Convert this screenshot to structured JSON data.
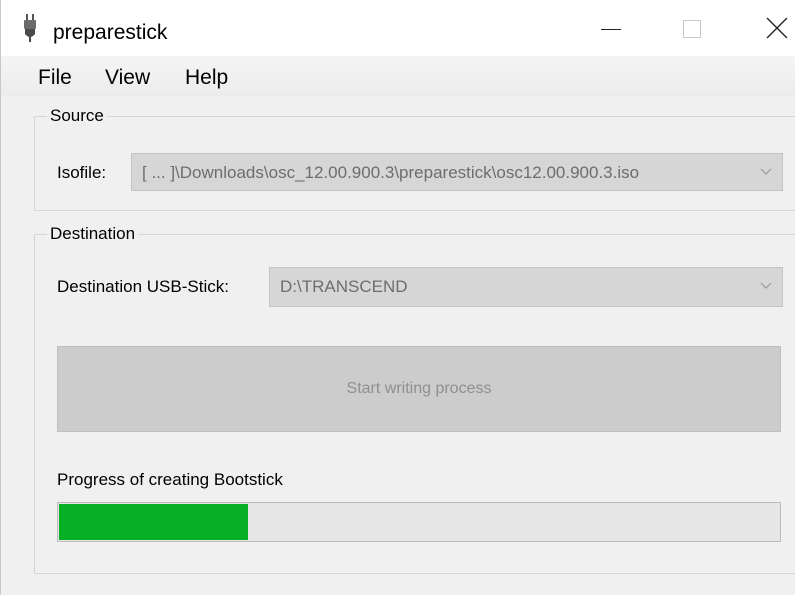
{
  "window": {
    "title": "preparestick",
    "app_icon": "usb-plug-icon",
    "controls": {
      "minimize": "minimize-icon",
      "maximize": "maximize-icon",
      "close": "close-icon"
    }
  },
  "menu": {
    "items": [
      {
        "label": "File"
      },
      {
        "label": "View"
      },
      {
        "label": "Help"
      }
    ]
  },
  "source": {
    "group_label": "Source",
    "isofile_label": "Isofile:",
    "isofile_value": "[ ... ]\\Downloads\\osc_12.00.900.3\\preparestick\\osc12.00.900.3.iso"
  },
  "destination": {
    "group_label": "Destination",
    "usb_label": "Destination USB-Stick:",
    "usb_value": "D:\\TRANSCEND",
    "start_button_label": "Start writing process",
    "progress_label": "Progress of creating Bootstick",
    "progress_fraction": 0.265,
    "progress_color": "#06b025"
  }
}
